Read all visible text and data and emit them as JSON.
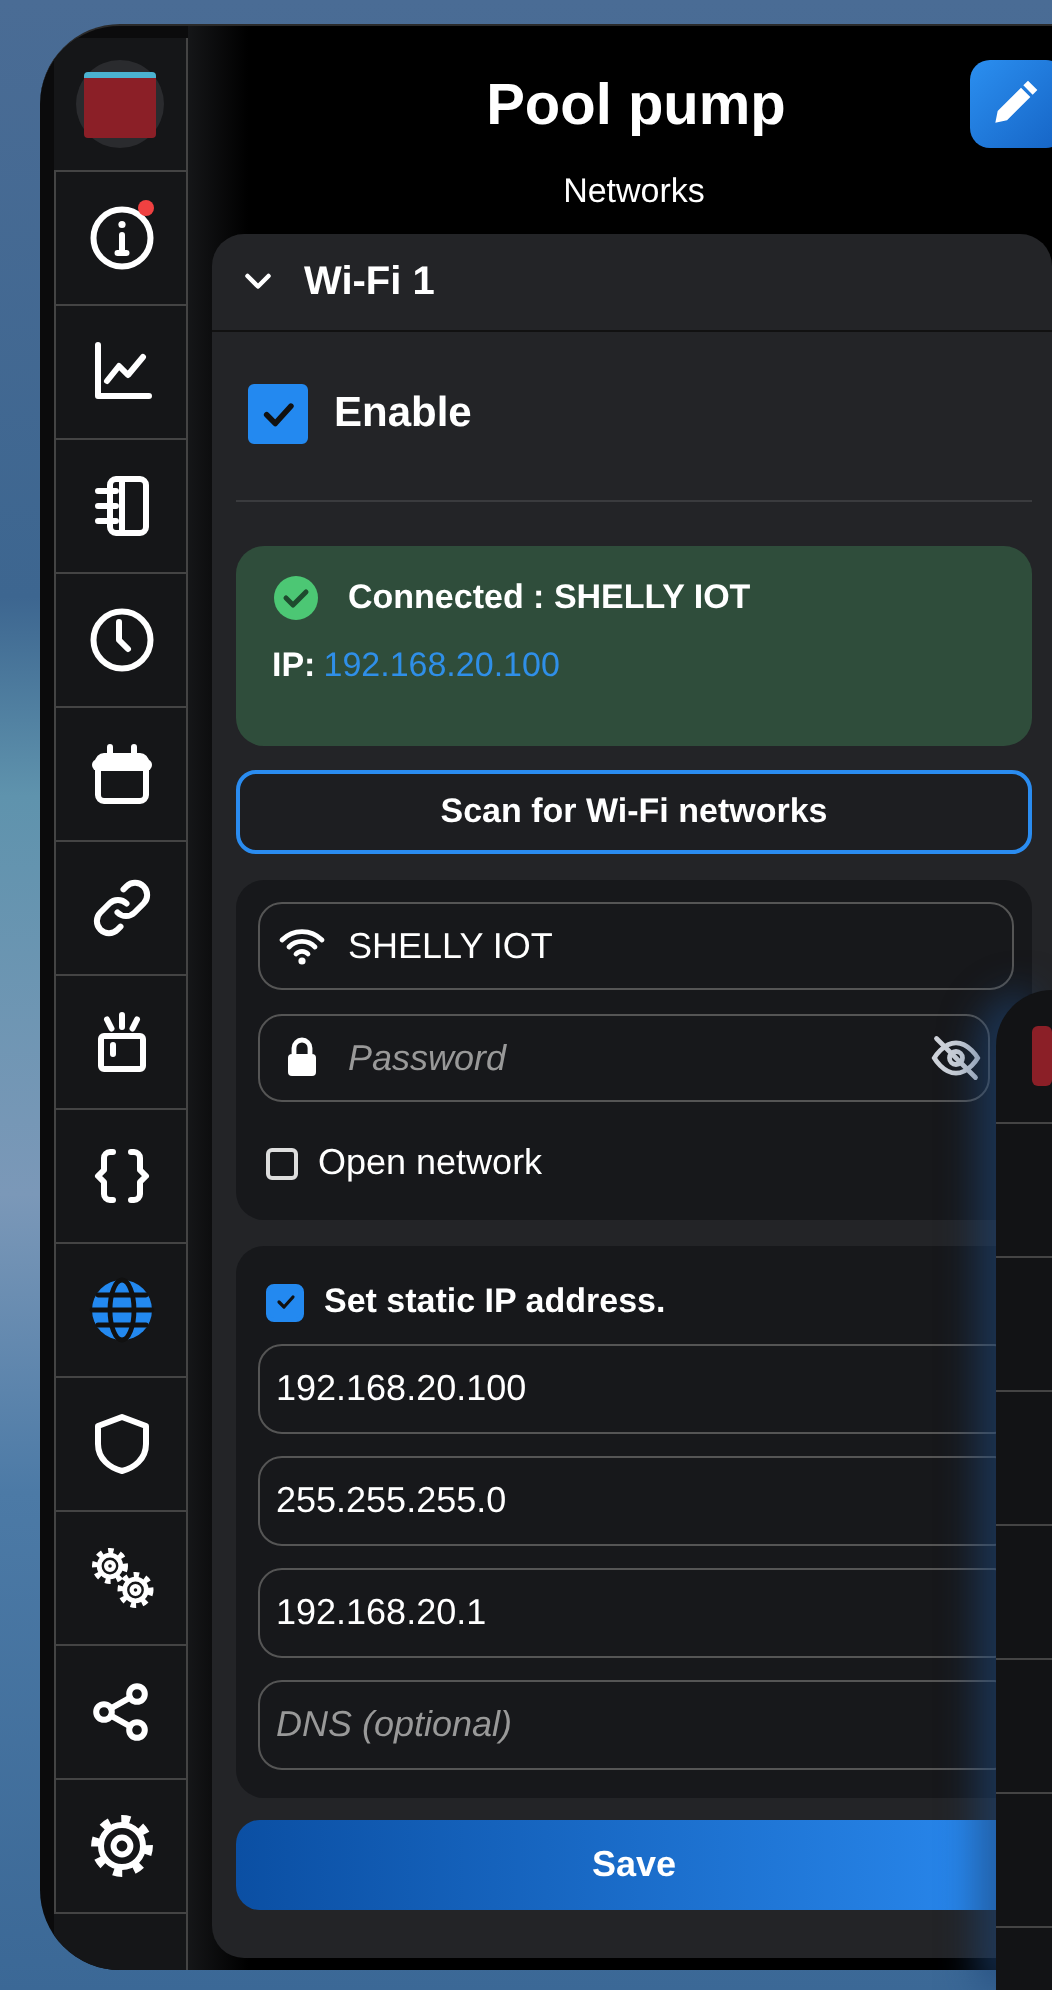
{
  "header": {
    "title": "Pool pump",
    "subtitle": "Networks"
  },
  "sidebar": {
    "items": [
      {
        "kind": "device",
        "selected": false,
        "notification": false
      },
      {
        "kind": "info",
        "selected": false,
        "notification": true
      },
      {
        "kind": "chart",
        "selected": false,
        "notification": false
      },
      {
        "kind": "ledger",
        "selected": false,
        "notification": false
      },
      {
        "kind": "clock",
        "selected": false,
        "notification": false
      },
      {
        "kind": "calendar",
        "selected": false,
        "notification": false
      },
      {
        "kind": "link",
        "selected": false,
        "notification": false
      },
      {
        "kind": "lamp",
        "selected": false,
        "notification": false
      },
      {
        "kind": "braces",
        "selected": false,
        "notification": false
      },
      {
        "kind": "globe",
        "selected": true,
        "notification": false
      },
      {
        "kind": "shield",
        "selected": false,
        "notification": false
      },
      {
        "kind": "gears",
        "selected": false,
        "notification": false
      },
      {
        "kind": "share",
        "selected": false,
        "notification": false
      },
      {
        "kind": "settings",
        "selected": false,
        "notification": false
      }
    ]
  },
  "section": {
    "title": "Wi-Fi 1",
    "expanded": true,
    "enable": {
      "label": "Enable",
      "checked": true
    },
    "status": {
      "text": "Connected : SHELLY IOT",
      "ip_label": "IP:",
      "ip": "192.168.20.100"
    },
    "scan_button": "Scan for Wi-Fi networks",
    "ssid": {
      "value": "SHELLY IOT"
    },
    "password": {
      "placeholder": "Password"
    },
    "open_network": {
      "label": "Open network",
      "checked": false
    },
    "static_ip": {
      "label": "Set static IP address.",
      "checked": true
    },
    "ip_fields": [
      {
        "value": "192.168.20.100"
      },
      {
        "value": "255.255.255.0"
      },
      {
        "value": "192.168.20.1"
      },
      {
        "placeholder": "DNS (optional)"
      }
    ],
    "save_button": "Save"
  }
}
